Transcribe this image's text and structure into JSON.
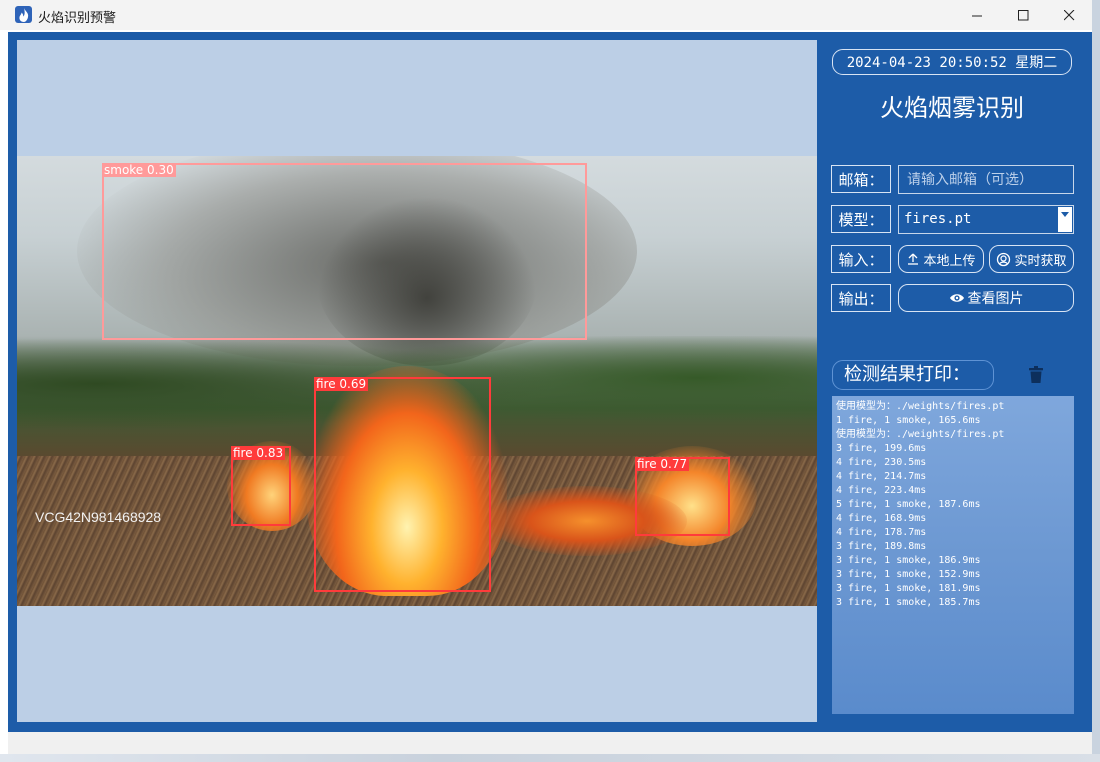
{
  "window": {
    "title": "火焰识别预警",
    "minimize_symbol": "—",
    "maximize_symbol": "☐",
    "close_symbol": "✕"
  },
  "panel": {
    "datetime": "2024-04-23 20:50:52 星期二",
    "app_title": "火焰烟雾识别",
    "email": {
      "label": "邮箱：",
      "placeholder": "请输入邮箱（可选）",
      "value": ""
    },
    "model": {
      "label": "模型：",
      "selected": "fires.pt"
    },
    "input": {
      "label": "输入：",
      "upload_label": "本地上传",
      "realtime_label": "实时获取"
    },
    "output": {
      "label": "输出：",
      "view_label": "查看图片"
    },
    "results_title": "检测结果打印："
  },
  "detections": [
    {
      "label": "smoke 0.30",
      "class": "smoke"
    },
    {
      "label": "fire 0.69",
      "class": "fire"
    },
    {
      "label": "fire 0.83",
      "class": "fire"
    },
    {
      "label": "fire 0.77",
      "class": "fire"
    }
  ],
  "frame": {
    "watermark": "VCG42N981468928"
  },
  "log_lines": [
    "使用模型为：./weights/fires.pt",
    "1 fire, 1 smoke, 165.6ms",
    "使用模型为：./weights/fires.pt",
    "3 fire, 199.6ms",
    "4 fire, 230.5ms",
    "4 fire, 214.7ms",
    "4 fire, 223.4ms",
    "5 fire, 1 smoke, 187.6ms",
    "4 fire, 168.9ms",
    "4 fire, 178.7ms",
    "3 fire, 189.8ms",
    "3 fire, 1 smoke, 186.9ms",
    "3 fire, 1 smoke, 152.9ms",
    "3 fire, 1 smoke, 181.9ms",
    "3 fire, 1 smoke, 185.7ms"
  ],
  "icons": {
    "app": "flame-icon",
    "upload": "upload-icon",
    "realtime": "camera-icon",
    "view": "eye-icon",
    "clear": "trash-icon",
    "dropdown": "chevron-down-icon"
  },
  "colors": {
    "panel_bg": "#1d5ca8",
    "display_bg": "#bccfe6",
    "fire_box": "#ff3b3b",
    "smoke_box": "#ff9a9a"
  }
}
